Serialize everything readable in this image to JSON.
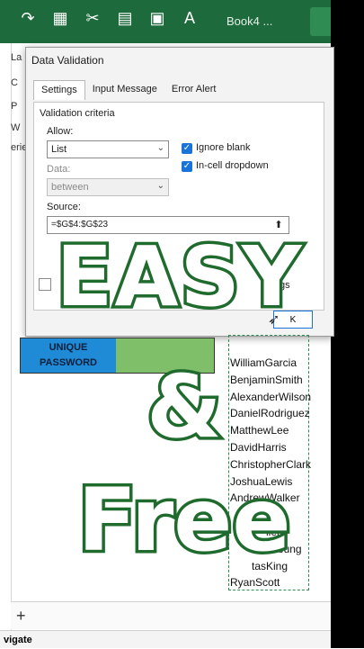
{
  "ribbon": {
    "icons": [
      "redo-icon",
      "table-icon",
      "cut-icon",
      "calculator-icon",
      "image-icon",
      "font-color-icon"
    ],
    "doc_title": "Book4 ..."
  },
  "left_fragments": [
    "La",
    "C",
    "P",
    "W",
    "erie"
  ],
  "dialog": {
    "title": "Data Validation",
    "tabs": [
      "Settings",
      "Input Message",
      "Error Alert"
    ],
    "active_tab": "Settings",
    "section_label": "Validation criteria",
    "allow_label": "Allow:",
    "allow_value": "List",
    "data_label": "Data:",
    "data_value": "between",
    "ignore_blank_label": "Ignore blank",
    "ignore_blank_checked": true,
    "incell_label": "In-cell dropdown",
    "incell_checked": true,
    "source_label": "Source:",
    "source_value": "=$G$4:$G$23",
    "apply_suffix": "gs",
    "ok_label": "K"
  },
  "sheet": {
    "unique_label_line1": "UNIQUE",
    "unique_label_line2": "PASSWORD",
    "names": [
      "WilliamGarcia",
      "BenjaminSmith",
      "AlexanderWilson",
      "DanielRodriguez",
      "MatthewLee",
      "DavidHarris",
      "ChristopherClark",
      "JoshuaLewis",
      "AndrewWalker",
      "all",
      "llen",
      "Young",
      "tasKing",
      "RyanScott"
    ],
    "bottom_nav": "vigate"
  },
  "overlay": {
    "line1": "EASY",
    "line2": "&",
    "line3": "Free"
  },
  "colors": {
    "ribbon": "#1d6b3c",
    "accent": "#1a73d9",
    "overlay_stroke": "#1f6b2d"
  }
}
